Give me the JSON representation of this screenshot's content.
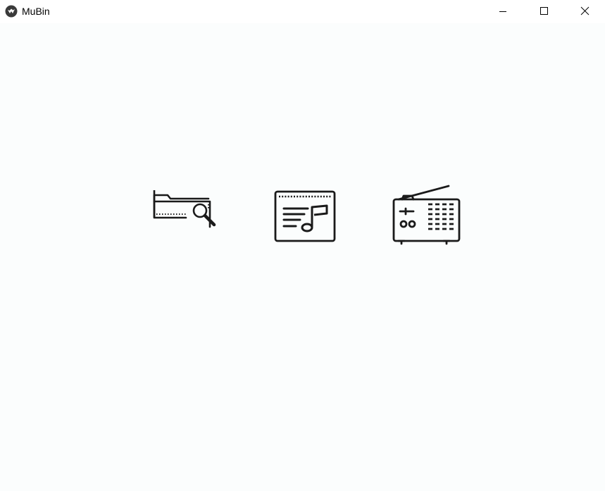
{
  "window": {
    "title": "MuBin",
    "app_icon": "mubin-logo-icon",
    "controls": {
      "minimize": "minimize-icon",
      "maximize": "maximize-icon",
      "close": "close-icon"
    }
  },
  "main": {
    "tiles": [
      {
        "id": "browse-folder",
        "icon": "folder-search-icon"
      },
      {
        "id": "music-library",
        "icon": "music-list-icon"
      },
      {
        "id": "radio",
        "icon": "radio-icon"
      }
    ]
  },
  "colors": {
    "content_background": "#fbfdfd",
    "icon_stroke": "#1a1a1a",
    "titlebar_background": "#ffffff"
  }
}
